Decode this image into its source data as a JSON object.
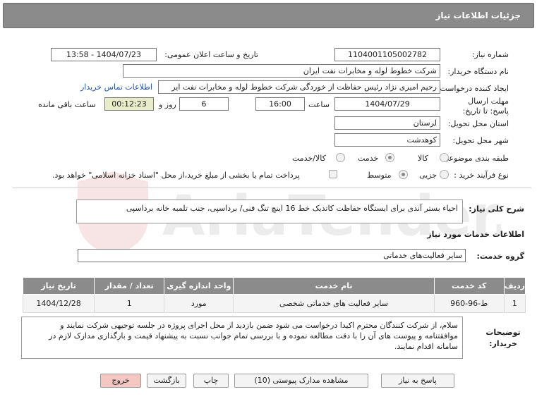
{
  "header": {
    "title": "جزئیات اطلاعات نیاز"
  },
  "fields": {
    "need_number_label": "شماره نیاز:",
    "need_number": "1104001105002782",
    "announce_label": "تاریخ و ساعت اعلان عمومی:",
    "announce_value": "1404/07/23 - 13:58",
    "buyer_org_label": "نام دستگاه خریدار:",
    "buyer_org": "شرکت خطوط لوله و مخابرات نفت ایران",
    "creator_label": "ایجاد کننده درخواست:",
    "creator": "رحیم  امیری نژاد رئیس حفاظت از خوردگی شرکت خطوط لوله و مخابرات نفت ایر",
    "contact_link": "اطلاعات تماس خریدار",
    "deadline_label": "مهلت ارسال پاسخ: تا تاریخ:",
    "deadline_date": "1404/07/29",
    "time_label": "ساعت",
    "deadline_time": "16:00",
    "days_value": "6",
    "days_label": "روز و",
    "remaining_time": "00:12:23",
    "remaining_label": "ساعت باقی مانده",
    "province_label": "استان محل تحویل:",
    "province": "لرستان",
    "city_label": "شهر محل تحویل:",
    "city": "کوهدشت",
    "category_label": "طبقه بندی موضوعی:",
    "category_options": [
      "کالا",
      "خدمت",
      "کالا/خدمت"
    ],
    "category_selected": "خدمت",
    "process_label": "نوع فرآیند خرید :",
    "process_options": [
      "جزیی",
      "متوسط"
    ],
    "process_selected": "متوسط",
    "payment_note": "پرداخت تمام یا بخشی از مبلغ خرید،از محل \"اسناد خزانه اسلامی\" خواهد بود."
  },
  "summary": {
    "label": "شرح کلی نیاز:",
    "text": "احیاء بستر آندی برای ایستگاه حفاظت کاتدیک خط 16 اینچ تنگ فنی/ برداسپی، جنب تلمبه خانه برداسپی"
  },
  "services": {
    "section_title": "اطلاعات خدمات مورد نیاز",
    "group_label": "گروه خدمت:",
    "group_value": "سایر فعالیت‌های خدماتی",
    "columns": [
      "ردیف",
      "کد خدمت",
      "نام خدمت",
      "واحد اندازه گیری",
      "تعداد / مقدار",
      "تاریخ نیاز"
    ],
    "rows": [
      [
        "1",
        "ط-96-960",
        "سایر فعالیت های خدماتی شخصی",
        "مورد",
        "1",
        "1404/12/28"
      ]
    ]
  },
  "buyer_notes": {
    "label": "توضیحات خریدار:",
    "text": "سلام، از شرکت کنندگان محترم اکیدا درخواست می شود ضمن بازدید از محل اجرای پروژه در جلسه توجیهی شرکت نمایند و موافقتنامه و پیوست های آن را با دقت مطالعه نموده و با بررسی تمام جوانب نسبت به پیشنهاد قیمت و بارگذاری مدارک لازم در سامانه اقدام نمایند."
  },
  "buttons": {
    "reply": "پاسخ به نیاز",
    "attachments": "مشاهده مدارک پیوستی (10)",
    "print": "چاپ",
    "back": "بازگشت",
    "exit": "خروج"
  },
  "watermark": "AriaTender.net",
  "colors": {
    "header_bg": "#8b8b8b",
    "timer_bg": "#e8ecc8",
    "exit_bg": "#f4c7c3",
    "link": "#1a4fb8"
  }
}
